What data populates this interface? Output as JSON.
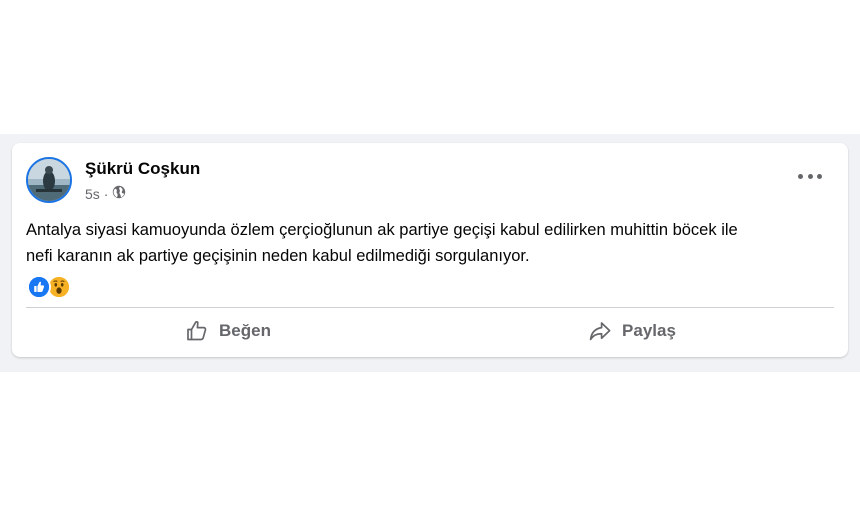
{
  "post": {
    "author": "Şükrü Coşkun",
    "time": "5s",
    "separator": "·",
    "privacy_icon": "globe-icon",
    "text": "Antalya siyasi kamuoyunda özlem çerçioğlunun ak partiye geçişi kabul edilirken muhittin böcek ile\nnefi karanın ak partiye  geçişinin neden kabul edilmediği sorgulanıyor.",
    "reactions": [
      "like-reaction-icon",
      "wow-reaction-icon"
    ]
  },
  "actions": {
    "like_label": "Beğen",
    "share_label": "Paylaş"
  },
  "colors": {
    "background": "#f0f2f5",
    "text": "#050505",
    "secondary_text": "#65676b",
    "like_blue": "#1877f2",
    "wow_yellow": "#f7b125"
  }
}
